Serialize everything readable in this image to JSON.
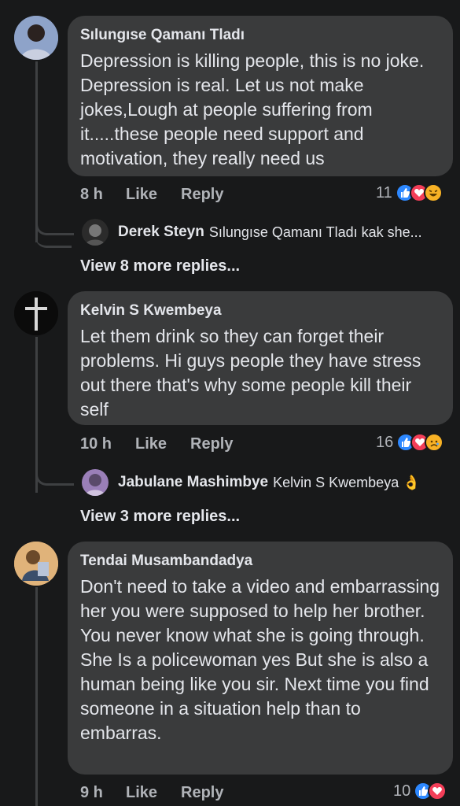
{
  "comments": [
    {
      "author": "Sılungıse Qamanı Tladı",
      "text": "Depression is killing people, this is no joke. Depression is real. Let us not make jokes,Lough at people suffering from it.....these people need support and motivation, they really need us",
      "time": "8 h",
      "like": "Like",
      "reply": "Reply",
      "reaction_count": "11",
      "reactions": [
        "like",
        "love",
        "haha"
      ],
      "preview_reply": {
        "author": "Derek Steyn",
        "text": "Sılungıse Qamanı Tladı kak she..."
      },
      "view_more": "View 8 more replies..."
    },
    {
      "author": "Kelvin S Kwembeya",
      "text": "Let them drink so they can forget their problems. Hi guys people they have stress out there that's why some people kill their self",
      "time": "10 h",
      "like": "Like",
      "reply": "Reply",
      "reaction_count": "16",
      "reactions": [
        "like",
        "love",
        "sad"
      ],
      "preview_reply": {
        "author": "Jabulane Mashimbye",
        "text": "Kelvin S Kwembeya 👌"
      },
      "view_more": "View 3 more replies..."
    },
    {
      "author": "Tendai Musambandadya",
      "text": "Don't need to take a video and embarrassing her you were supposed to help her brother. You never know what she is going through. She Is a policewoman yes But  she is also a human being like you sir. Next time you find someone in a situation help than to embarras.",
      "time": "9 h",
      "like": "Like",
      "reply": "Reply",
      "reaction_count": "10",
      "reactions": [
        "like",
        "love"
      ]
    }
  ],
  "colors": {
    "background": "#18191a",
    "bubble": "#3a3b3c",
    "like": "#2d88ff",
    "love": "#f33e58",
    "haha": "#f7b125"
  }
}
